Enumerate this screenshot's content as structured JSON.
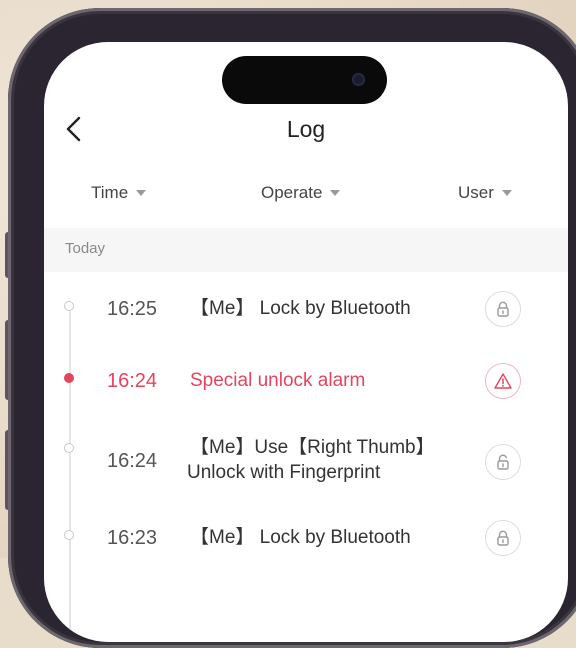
{
  "header": {
    "title": "Log"
  },
  "filters": [
    {
      "label": "Time"
    },
    {
      "label": "Operate"
    },
    {
      "label": "User"
    }
  ],
  "section": {
    "label": "Today"
  },
  "colors": {
    "alarm": "#e4455e",
    "text": "#333333",
    "muted": "#8a8a8a"
  },
  "logs": [
    {
      "time": "16:25",
      "line1": "【Me】 Lock by Bluetooth",
      "line2": "",
      "icon": "lock-icon",
      "alarm": false
    },
    {
      "time": "16:24",
      "line1": "Special unlock alarm",
      "line2": "",
      "icon": "warning-icon",
      "alarm": true
    },
    {
      "time": "16:24",
      "line1": "【Me】Use【Right Thumb】",
      "line2": "Unlock with Fingerprint",
      "icon": "unlock-icon",
      "alarm": false
    },
    {
      "time": "16:23",
      "line1": "【Me】 Lock by Bluetooth",
      "line2": "",
      "icon": "lock-icon",
      "alarm": false
    }
  ]
}
